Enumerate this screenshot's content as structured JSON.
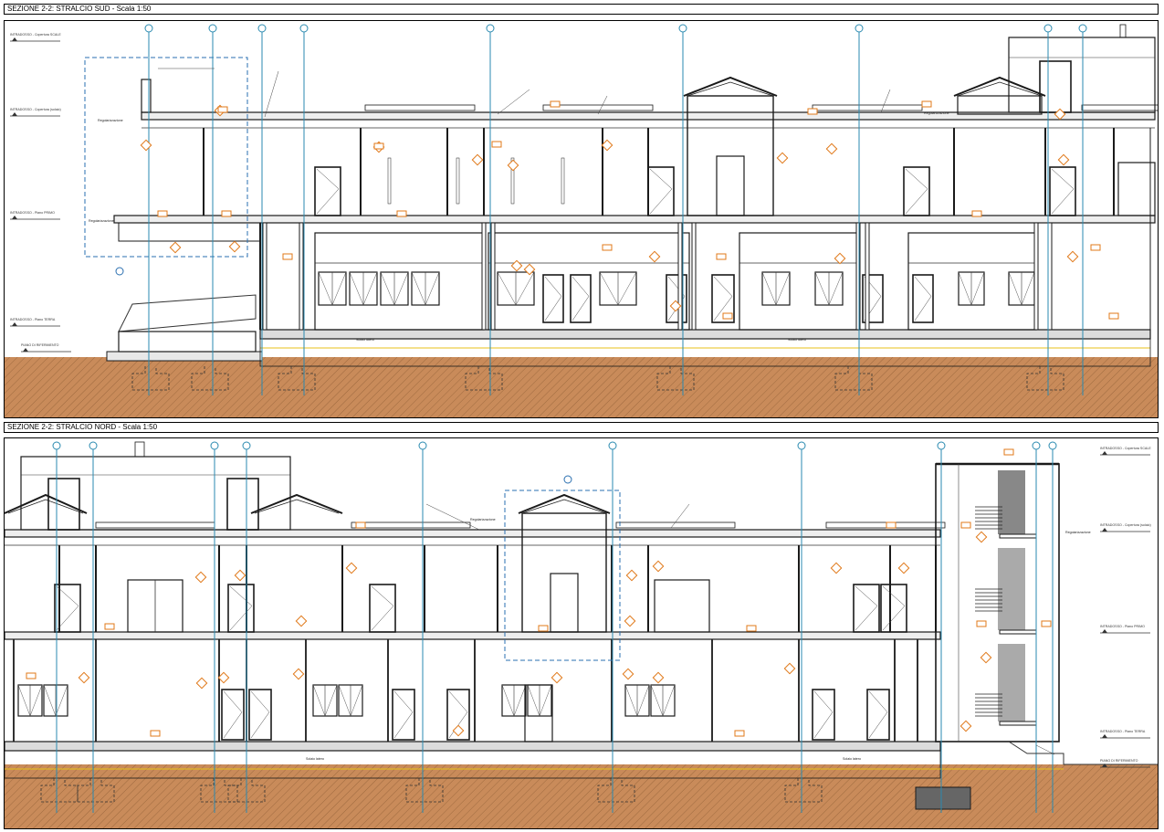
{
  "sections": [
    {
      "title": "SEZIONE 2-2: STRALCIO SUD - Scala 1:50",
      "level_labels": [
        "INTRADOSSO - Copertura SCALE",
        "INTRADOSSO - Copertura (solaio)",
        "INTRADOSSO - Piano PRIMO",
        "INTRADOSSO - Piano TERRA",
        "PIANO DI RIFERIMENTO"
      ],
      "annotations": [
        "Regolarizzazione",
        "Regolarizzazione",
        "Solaio latero",
        "Solaio latero",
        "Regolarizzazione"
      ],
      "grid_count": 9
    },
    {
      "title": "SEZIONE 2-2: STRALCIO NORD - Scala 1:50",
      "level_labels": [
        "INTRADOSSO - Copertura SCALE",
        "INTRADOSSO - Copertura (solaio)",
        "INTRADOSSO - Piano PRIMO",
        "INTRADOSSO - Piano TERRA",
        "PIANO DI RIFERIMENTO"
      ],
      "annotations": [
        "Regolarizzazione",
        "Regolarizzazione",
        "Solaio latero",
        "Solaio latero"
      ],
      "grid_count": 9
    }
  ],
  "colors": {
    "line": "#1a1a1a",
    "grid": "#2a8ab0",
    "tag": "#e07818",
    "soil": "#c98b5a",
    "soil_hatch": "#9e6a3f",
    "dash": "#2a6fb0",
    "yellow": "#e8c21a"
  }
}
